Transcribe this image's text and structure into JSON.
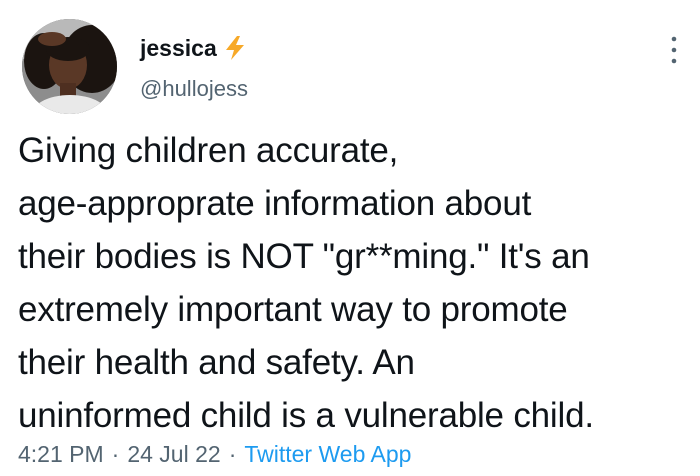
{
  "author": {
    "display_name": "jessica",
    "handle": "@hullojess",
    "badge_icon": "lightning-bolt-icon",
    "badge_color": "#f7a928"
  },
  "menu_icon": "more-vertical-icon",
  "tweet": {
    "lines": [
      "Giving children accurate,",
      "age-approprate information about",
      "their bodies is NOT \"gr**ming.\" It's an",
      "extremely important way to promote",
      "their health and safety. An",
      "uninformed child is a vulnerable child."
    ]
  },
  "meta": {
    "time": "4:21 PM",
    "separator": "·",
    "date": "24 Jul 22",
    "source": "Twitter Web App"
  },
  "colors": {
    "text": "#0f1419",
    "secondary": "#536471",
    "link": "#1d9bf0"
  }
}
